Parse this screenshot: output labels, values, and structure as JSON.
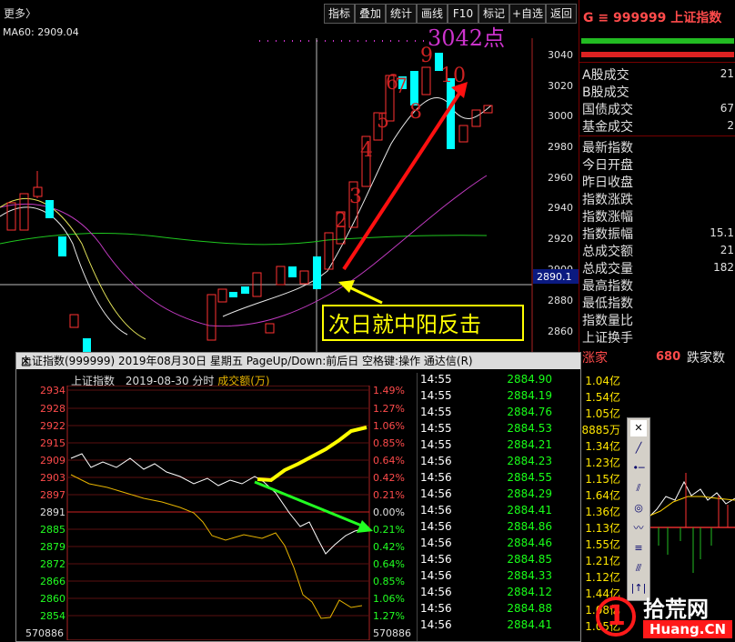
{
  "toolbar": {
    "more": "更多〉",
    "buttons": [
      "指标",
      "叠加",
      "统计",
      "画线",
      "F10",
      "标记",
      "+自选",
      "返回"
    ]
  },
  "main_chart": {
    "indicator": "MA60: 2909.04",
    "peak_label": "3042点",
    "annotation": "次日就中阳反击",
    "count_labels": [
      "2",
      "3",
      "4",
      "5",
      "6",
      "7",
      "8",
      "9",
      "10"
    ],
    "y_ticks": [
      "3040",
      "3020",
      "3000",
      "2980",
      "2960",
      "2940",
      "2920",
      "2900",
      "2880",
      "2860"
    ],
    "crosshair_price": "2890.1"
  },
  "right_panel": {
    "title": "G ≡ 999999 上证指数",
    "rows": [
      {
        "label": "A股成交",
        "value": "21"
      },
      {
        "label": "B股成交",
        "value": ""
      },
      {
        "label": "国债成交",
        "value": "67"
      },
      {
        "label": "基金成交",
        "value": "2"
      },
      {
        "label": "最新指数",
        "value": ""
      },
      {
        "label": "今日开盘",
        "value": ""
      },
      {
        "label": "昨日收盘",
        "value": ""
      },
      {
        "label": "指数涨跌",
        "value": ""
      },
      {
        "label": "指数涨幅",
        "value": ""
      },
      {
        "label": "指数振幅",
        "value": "15.1"
      },
      {
        "label": "总成交额",
        "value": "21"
      },
      {
        "label": "总成交量",
        "value": "182"
      },
      {
        "label": "最高指数",
        "value": ""
      },
      {
        "label": "最低指数",
        "value": ""
      },
      {
        "label": "指数量比",
        "value": ""
      },
      {
        "label": "上证换手",
        "value": ""
      }
    ],
    "bottom_value": "680",
    "bottom_label": "跌家数",
    "bottom_prefix": "涨家"
  },
  "popup": {
    "title": "上证指数(999999) 2019年08月30日 星期五 PageUp/Down:前后日 空格键:操作 通达信(R)",
    "chart_name": "上证指数",
    "chart_date": "2019-08-30 分时",
    "chart_vol": "成交额(万)",
    "left_ticks": [
      "2934",
      "2928",
      "2922",
      "2915",
      "2909",
      "2903",
      "2897",
      "2891",
      "2885",
      "2879",
      "2872",
      "2866",
      "2860",
      "2854"
    ],
    "right_ticks": [
      "1.49%",
      "1.27%",
      "1.06%",
      "0.85%",
      "0.64%",
      "0.42%",
      "0.21%",
      "0.00%",
      "0.21%",
      "0.42%",
      "0.64%",
      "0.85%",
      "1.06%",
      "1.27%"
    ],
    "bottom_left": "570886",
    "bottom_right": "570886",
    "ticks": [
      {
        "time": "14:55",
        "price": "2884.90",
        "vol": "1.04亿"
      },
      {
        "time": "14:55",
        "price": "2884.19",
        "vol": "1.54亿"
      },
      {
        "time": "14:55",
        "price": "2884.76",
        "vol": "1.05亿"
      },
      {
        "time": "14:55",
        "price": "2884.53",
        "vol": "8885万"
      },
      {
        "time": "14:55",
        "price": "2884.21",
        "vol": "1.34亿"
      },
      {
        "time": "14:56",
        "price": "2884.23",
        "vol": "1.23亿"
      },
      {
        "time": "14:56",
        "price": "2884.55",
        "vol": "1.15亿"
      },
      {
        "time": "14:56",
        "price": "2884.29",
        "vol": "1.64亿"
      },
      {
        "time": "14:56",
        "price": "2884.41",
        "vol": "1.36亿"
      },
      {
        "time": "14:56",
        "price": "2884.86",
        "vol": "1.13亿"
      },
      {
        "time": "14:56",
        "price": "2884.46",
        "vol": "1.55亿"
      },
      {
        "time": "14:56",
        "price": "2884.85",
        "vol": "1.21亿"
      },
      {
        "time": "14:56",
        "price": "2884.33",
        "vol": "1.12亿"
      },
      {
        "time": "14:56",
        "price": "2884.12",
        "vol": "1.44亿"
      },
      {
        "time": "14:56",
        "price": "2884.88",
        "vol": "1.08亿"
      },
      {
        "time": "14:56",
        "price": "2884.41",
        "vol": "1.05亿"
      }
    ]
  },
  "watermark": {
    "line1": "拾荒网",
    "line2": "Huang.CN"
  },
  "colors": {
    "up": "#ff3232",
    "down": "#00ffff",
    "accent": "#ffff00"
  }
}
